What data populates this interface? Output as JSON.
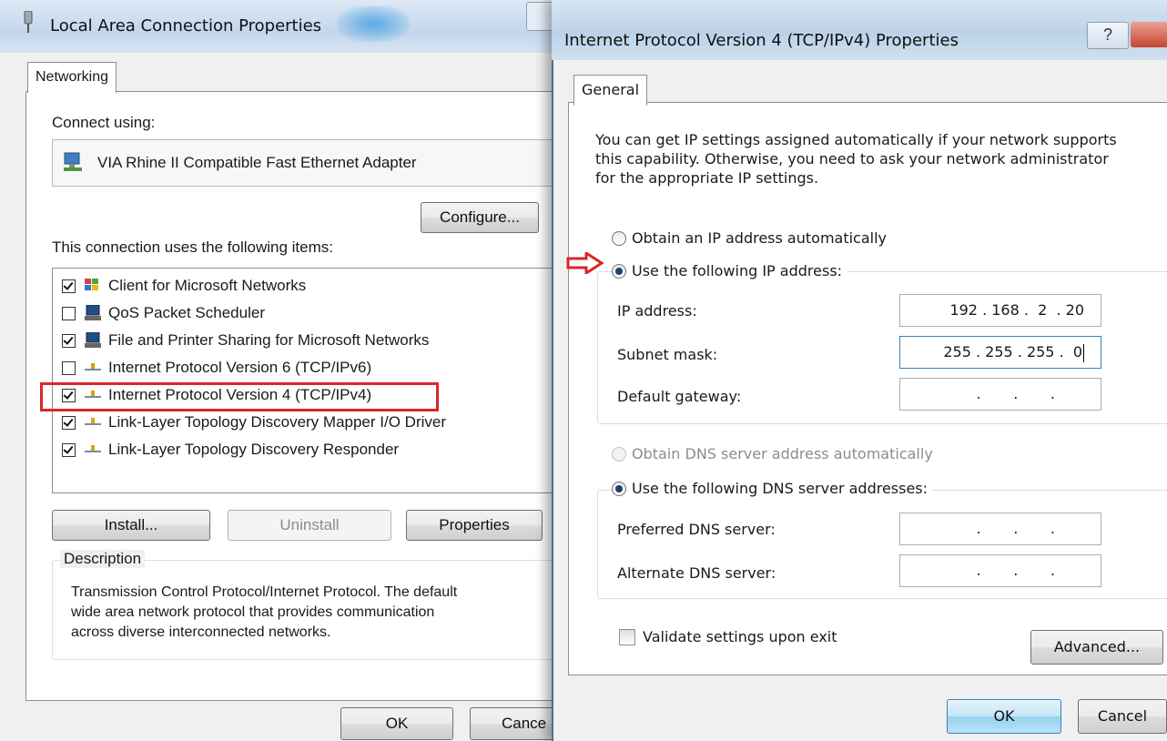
{
  "left_window": {
    "title": "Local Area Connection Properties",
    "tab": "Networking",
    "connect_using_label": "Connect using:",
    "adapter_name": "VIA Rhine II Compatible Fast Ethernet Adapter",
    "configure_button": "Configure...",
    "items_label": "This connection uses the following items:",
    "items": [
      {
        "label": "Client for Microsoft Networks",
        "checked": true,
        "icon": "network-client-icon"
      },
      {
        "label": "QoS Packet Scheduler",
        "checked": false,
        "icon": "computer-service-icon"
      },
      {
        "label": "File and Printer Sharing for Microsoft Networks",
        "checked": true,
        "icon": "computer-service-icon"
      },
      {
        "label": "Internet Protocol Version 6 (TCP/IPv6)",
        "checked": false,
        "icon": "protocol-icon"
      },
      {
        "label": "Internet Protocol Version 4 (TCP/IPv4)",
        "checked": true,
        "icon": "protocol-icon",
        "highlighted": true
      },
      {
        "label": "Link-Layer Topology Discovery Mapper I/O Driver",
        "checked": true,
        "icon": "protocol-icon"
      },
      {
        "label": "Link-Layer Topology Discovery Responder",
        "checked": true,
        "icon": "protocol-icon"
      }
    ],
    "install_button": "Install...",
    "uninstall_button": "Uninstall",
    "properties_button": "Properties",
    "description_legend": "Description",
    "description_lines": [
      "Transmission Control Protocol/Internet Protocol. The default",
      "wide area network protocol that provides communication",
      "across diverse interconnected networks."
    ],
    "ok_button": "OK",
    "cancel_button": "Cance"
  },
  "right_window": {
    "title": "Internet Protocol Version 4 (TCP/IPv4) Properties",
    "help_button": "?",
    "tab": "General",
    "intro_lines": [
      "You can get IP settings assigned automatically if your network supports",
      "this capability. Otherwise, you need to ask your network administrator",
      "for the appropriate IP settings."
    ],
    "obtain_ip_auto": "Obtain an IP address automatically",
    "use_following_ip": "Use the following IP address:",
    "ip_address_label": "IP address:",
    "ip_address_value": "192 . 168 .  2  . 20",
    "subnet_mask_label": "Subnet mask:",
    "subnet_mask_value": "255 . 255 . 255 .  0",
    "default_gateway_label": "Default gateway:",
    "default_gateway_value": ".       .       .",
    "obtain_dns_auto": "Obtain DNS server address automatically",
    "use_following_dns": "Use the following DNS server addresses:",
    "preferred_dns_label": "Preferred DNS server:",
    "preferred_dns_value": ".       .       .",
    "alternate_dns_label": "Alternate DNS server:",
    "alternate_dns_value": ".       .       .",
    "validate_label": "Validate settings upon exit",
    "validate_checked": false,
    "advanced_button": "Advanced...",
    "ok_button": "OK",
    "cancel_button": "Cancel"
  },
  "annotation_color": "#d9262b",
  "selected_radio_ip": "use_following_ip",
  "selected_radio_dns": "use_following_dns"
}
